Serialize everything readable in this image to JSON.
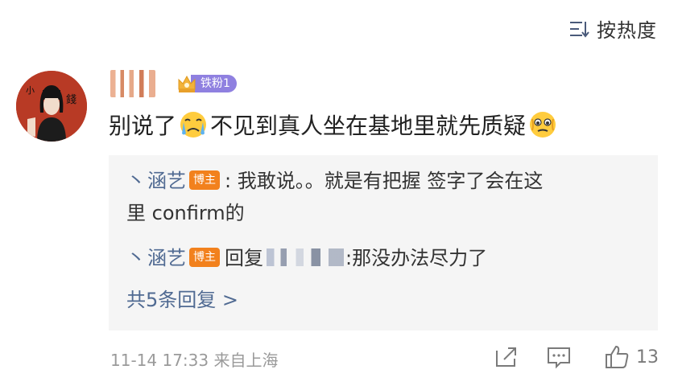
{
  "sort": {
    "label": "按热度",
    "icon": "sort-icon"
  },
  "comment": {
    "avatar_text_left": "小",
    "avatar_text_right": "錢",
    "fan_badge": "铁粉1",
    "text_before": "别说了",
    "emoji_1": "crying-face-emoji",
    "text_middle": "不见到真人坐在基地里就先质疑",
    "emoji_2": "holding-back-tears-emoji"
  },
  "replies": [
    {
      "prefix": "丶",
      "name": "涵艺",
      "badge": "博主",
      "text": ": 我敢说。。就是有把握 签字了会在这",
      "text_cont": "里 confirm的"
    },
    {
      "prefix": "丶",
      "name": "涵艺",
      "badge": "博主",
      "reply_word": "回复",
      "text": ":那没办法尽力了"
    }
  ],
  "more_replies": "共5条回复 >",
  "meta": "11-14 17:33  来自上海",
  "actions": {
    "share_icon": "share-icon",
    "comment_icon": "comment-icon",
    "like_icon": "thumbs-up-icon",
    "like_count": "13"
  },
  "colors": {
    "link": "#506a92",
    "badge": "#f2811d",
    "fan_badge": "#8f80e0",
    "avatar_bg": "#b83a25"
  }
}
